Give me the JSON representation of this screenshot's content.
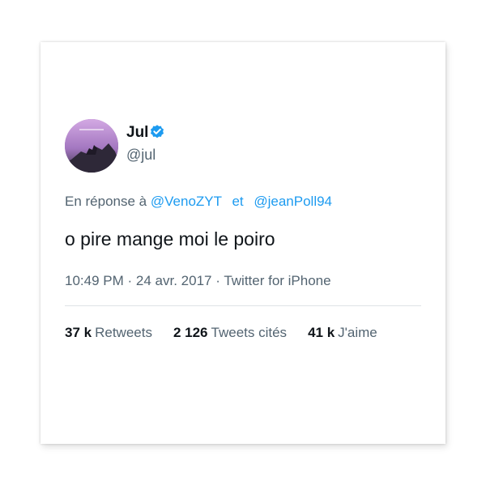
{
  "tweet": {
    "display_name": "Jul",
    "handle": "@jul",
    "reply_prefix": "En réponse à",
    "reply_to": [
      "@VenoZYT",
      "@jeanPoll94"
    ],
    "reply_separator": "et",
    "text": "o pire mange moi le poiro",
    "time": "10:49 PM",
    "date": "24 avr. 2017",
    "source": "Twitter for iPhone",
    "meta_dot": "·"
  },
  "stats": {
    "retweets_count": "37 k",
    "retweets_label": "Retweets",
    "quotes_count": "2 126",
    "quotes_label": "Tweets cités",
    "likes_count": "41 k",
    "likes_label": "J'aime"
  },
  "colors": {
    "link": "#1d9bf0",
    "secondary_text": "#536471",
    "primary_text": "#0f1419",
    "verified_badge": "#1d9bf0"
  },
  "icons": {
    "verified": "verified-badge-icon"
  }
}
